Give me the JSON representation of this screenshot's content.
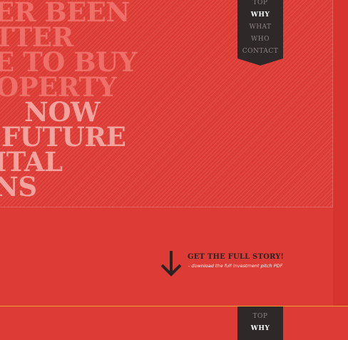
{
  "hero": {
    "headline_lines": [
      "ER BEEN",
      "TTER",
      "E TO BUY",
      "OPERTY",
      "NOW",
      "FUTURE",
      "ITAL",
      "NS"
    ]
  },
  "nav_top": {
    "items": [
      "TOP",
      "WHY",
      "WHAT",
      "WHO",
      "CONTACT"
    ],
    "active": "WHY"
  },
  "cta": {
    "title": "GET THE FULL STORY!",
    "subtitle": "- download the full investment pitch PDF",
    "icon": "arrow-down-icon"
  },
  "nav_bottom": {
    "items": [
      "TOP",
      "WHY"
    ],
    "active": "WHY"
  },
  "colors": {
    "background": "#dd3b35",
    "nav_bg": "#2f2828",
    "divider": "#f0a02c",
    "nav_active": "#ffffff",
    "nav_inactive": "#8c8483"
  }
}
